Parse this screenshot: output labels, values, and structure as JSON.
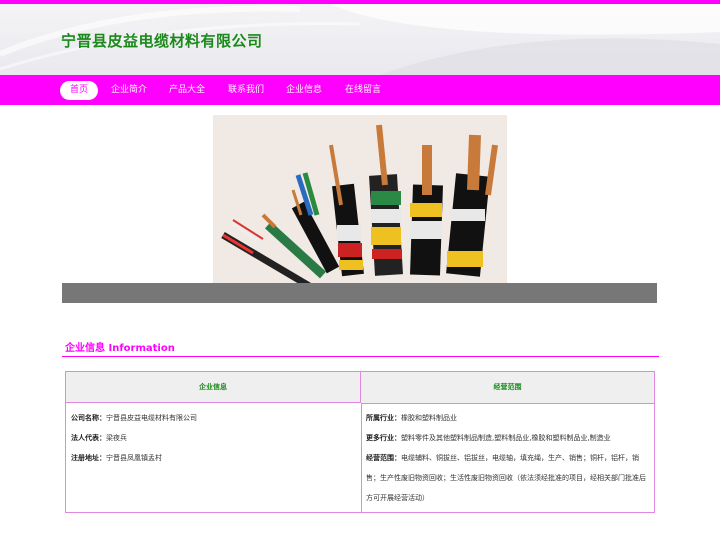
{
  "header": {
    "title": "宁晋县皮益电缆材料有限公司"
  },
  "nav": {
    "items": [
      "首页",
      "企业简介",
      "产品大全",
      "联系我们",
      "企业信息",
      "在线留言"
    ],
    "active": "首页"
  },
  "banner": {
    "image": "cable-products-photo"
  },
  "section": {
    "title_cn": "企业信息",
    "title_en": "Information"
  },
  "table": {
    "col_left": "企业信息",
    "col_right": "经营范围",
    "company_label": "公司名称：",
    "company_value": "宁晋县皮益电缆材料有限公司",
    "legal_label": "法人代表：",
    "legal_value": "梁夜兵",
    "address_label": "注册地址：",
    "address_value": "宁晋县凤凰镇孟村",
    "industry_label": "所属行业：",
    "industry_value": "橡胶和塑料制品业",
    "more_label": "更多行业：",
    "more_value": "塑料零件及其他塑料制品制造,塑料制品业,橡胶和塑料制品业,制造业",
    "scope_label": "经营范围：",
    "scope_value": "电缆辅料、铜拔丝、铝拔丝，电缆轴，填充绳，生产、销售；铜杆，铝杆，销售；生产性废旧物资回收；生活性废旧物资回收（依法须经批准的项目，经相关部门批准后方可开展经营活动）"
  },
  "colors": {
    "accent": "#ff00ff",
    "title_green": "#1a8a1a"
  }
}
